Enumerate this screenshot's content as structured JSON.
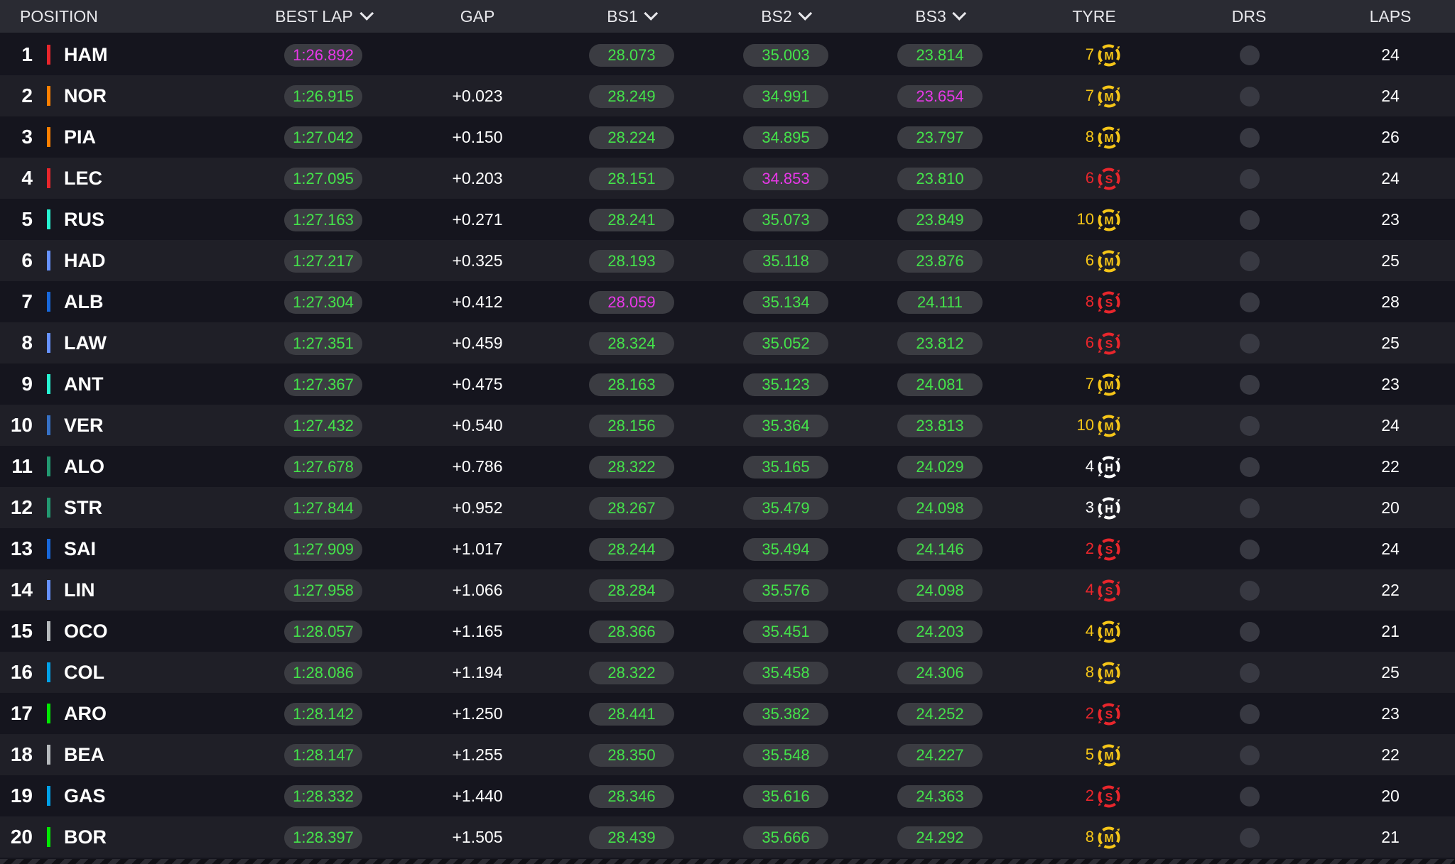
{
  "header": {
    "position": "POSITION",
    "best_lap": "BEST LAP",
    "gap": "GAP",
    "bs1": "BS1",
    "bs2": "BS2",
    "bs3": "BS3",
    "tyre": "TYRE",
    "drs": "DRS",
    "laps": "LAPS"
  },
  "colors": {
    "valid": "#44e34a",
    "best": "#e838e8",
    "medium": "#f5c518",
    "soft": "#e8262c",
    "hard": "#ffffff"
  },
  "rows": [
    {
      "pos": "1",
      "code": "HAM",
      "team_color": "#e8262c",
      "best_lap": "1:26.892",
      "best_is_overall": true,
      "gap": "",
      "bs1": "28.073",
      "bs1_best": false,
      "bs2": "35.003",
      "bs2_best": false,
      "bs3": "23.814",
      "bs3_best": false,
      "tyre_laps": "7",
      "tyre": "M",
      "laps": "24"
    },
    {
      "pos": "2",
      "code": "NOR",
      "team_color": "#ff8000",
      "best_lap": "1:26.915",
      "best_is_overall": false,
      "gap": "+0.023",
      "bs1": "28.249",
      "bs1_best": false,
      "bs2": "34.991",
      "bs2_best": false,
      "bs3": "23.654",
      "bs3_best": true,
      "tyre_laps": "7",
      "tyre": "M",
      "laps": "24"
    },
    {
      "pos": "3",
      "code": "PIA",
      "team_color": "#ff8000",
      "best_lap": "1:27.042",
      "best_is_overall": false,
      "gap": "+0.150",
      "bs1": "28.224",
      "bs1_best": false,
      "bs2": "34.895",
      "bs2_best": false,
      "bs3": "23.797",
      "bs3_best": false,
      "tyre_laps": "8",
      "tyre": "M",
      "laps": "26"
    },
    {
      "pos": "4",
      "code": "LEC",
      "team_color": "#e8262c",
      "best_lap": "1:27.095",
      "best_is_overall": false,
      "gap": "+0.203",
      "bs1": "28.151",
      "bs1_best": false,
      "bs2": "34.853",
      "bs2_best": true,
      "bs3": "23.810",
      "bs3_best": false,
      "tyre_laps": "6",
      "tyre": "S",
      "laps": "24"
    },
    {
      "pos": "5",
      "code": "RUS",
      "team_color": "#27f4d2",
      "best_lap": "1:27.163",
      "best_is_overall": false,
      "gap": "+0.271",
      "bs1": "28.241",
      "bs1_best": false,
      "bs2": "35.073",
      "bs2_best": false,
      "bs3": "23.849",
      "bs3_best": false,
      "tyre_laps": "10",
      "tyre": "M",
      "laps": "23"
    },
    {
      "pos": "6",
      "code": "HAD",
      "team_color": "#6692ff",
      "best_lap": "1:27.217",
      "best_is_overall": false,
      "gap": "+0.325",
      "bs1": "28.193",
      "bs1_best": false,
      "bs2": "35.118",
      "bs2_best": false,
      "bs3": "23.876",
      "bs3_best": false,
      "tyre_laps": "6",
      "tyre": "M",
      "laps": "25"
    },
    {
      "pos": "7",
      "code": "ALB",
      "team_color": "#1868db",
      "best_lap": "1:27.304",
      "best_is_overall": false,
      "gap": "+0.412",
      "bs1": "28.059",
      "bs1_best": true,
      "bs2": "35.134",
      "bs2_best": false,
      "bs3": "24.111",
      "bs3_best": false,
      "tyre_laps": "8",
      "tyre": "S",
      "laps": "28"
    },
    {
      "pos": "8",
      "code": "LAW",
      "team_color": "#6692ff",
      "best_lap": "1:27.351",
      "best_is_overall": false,
      "gap": "+0.459",
      "bs1": "28.324",
      "bs1_best": false,
      "bs2": "35.052",
      "bs2_best": false,
      "bs3": "23.812",
      "bs3_best": false,
      "tyre_laps": "6",
      "tyre": "S",
      "laps": "25"
    },
    {
      "pos": "9",
      "code": "ANT",
      "team_color": "#27f4d2",
      "best_lap": "1:27.367",
      "best_is_overall": false,
      "gap": "+0.475",
      "bs1": "28.163",
      "bs1_best": false,
      "bs2": "35.123",
      "bs2_best": false,
      "bs3": "24.081",
      "bs3_best": false,
      "tyre_laps": "7",
      "tyre": "M",
      "laps": "23"
    },
    {
      "pos": "10",
      "code": "VER",
      "team_color": "#3671c6",
      "best_lap": "1:27.432",
      "best_is_overall": false,
      "gap": "+0.540",
      "bs1": "28.156",
      "bs1_best": false,
      "bs2": "35.364",
      "bs2_best": false,
      "bs3": "23.813",
      "bs3_best": false,
      "tyre_laps": "10",
      "tyre": "M",
      "laps": "24"
    },
    {
      "pos": "11",
      "code": "ALO",
      "team_color": "#229971",
      "best_lap": "1:27.678",
      "best_is_overall": false,
      "gap": "+0.786",
      "bs1": "28.322",
      "bs1_best": false,
      "bs2": "35.165",
      "bs2_best": false,
      "bs3": "24.029",
      "bs3_best": false,
      "tyre_laps": "4",
      "tyre": "H",
      "laps": "22"
    },
    {
      "pos": "12",
      "code": "STR",
      "team_color": "#229971",
      "best_lap": "1:27.844",
      "best_is_overall": false,
      "gap": "+0.952",
      "bs1": "28.267",
      "bs1_best": false,
      "bs2": "35.479",
      "bs2_best": false,
      "bs3": "24.098",
      "bs3_best": false,
      "tyre_laps": "3",
      "tyre": "H",
      "laps": "20"
    },
    {
      "pos": "13",
      "code": "SAI",
      "team_color": "#1868db",
      "best_lap": "1:27.909",
      "best_is_overall": false,
      "gap": "+1.017",
      "bs1": "28.244",
      "bs1_best": false,
      "bs2": "35.494",
      "bs2_best": false,
      "bs3": "24.146",
      "bs3_best": false,
      "tyre_laps": "2",
      "tyre": "S",
      "laps": "24"
    },
    {
      "pos": "14",
      "code": "LIN",
      "team_color": "#6692ff",
      "best_lap": "1:27.958",
      "best_is_overall": false,
      "gap": "+1.066",
      "bs1": "28.284",
      "bs1_best": false,
      "bs2": "35.576",
      "bs2_best": false,
      "bs3": "24.098",
      "bs3_best": false,
      "tyre_laps": "4",
      "tyre": "S",
      "laps": "22"
    },
    {
      "pos": "15",
      "code": "OCO",
      "team_color": "#b6babd",
      "best_lap": "1:28.057",
      "best_is_overall": false,
      "gap": "+1.165",
      "bs1": "28.366",
      "bs1_best": false,
      "bs2": "35.451",
      "bs2_best": false,
      "bs3": "24.203",
      "bs3_best": false,
      "tyre_laps": "4",
      "tyre": "M",
      "laps": "21"
    },
    {
      "pos": "16",
      "code": "COL",
      "team_color": "#00a1e8",
      "best_lap": "1:28.086",
      "best_is_overall": false,
      "gap": "+1.194",
      "bs1": "28.322",
      "bs1_best": false,
      "bs2": "35.458",
      "bs2_best": false,
      "bs3": "24.306",
      "bs3_best": false,
      "tyre_laps": "8",
      "tyre": "M",
      "laps": "25"
    },
    {
      "pos": "17",
      "code": "ARO",
      "team_color": "#00e701",
      "best_lap": "1:28.142",
      "best_is_overall": false,
      "gap": "+1.250",
      "bs1": "28.441",
      "bs1_best": false,
      "bs2": "35.382",
      "bs2_best": false,
      "bs3": "24.252",
      "bs3_best": false,
      "tyre_laps": "2",
      "tyre": "S",
      "laps": "23"
    },
    {
      "pos": "18",
      "code": "BEA",
      "team_color": "#b6babd",
      "best_lap": "1:28.147",
      "best_is_overall": false,
      "gap": "+1.255",
      "bs1": "28.350",
      "bs1_best": false,
      "bs2": "35.548",
      "bs2_best": false,
      "bs3": "24.227",
      "bs3_best": false,
      "tyre_laps": "5",
      "tyre": "M",
      "laps": "22"
    },
    {
      "pos": "19",
      "code": "GAS",
      "team_color": "#00a1e8",
      "best_lap": "1:28.332",
      "best_is_overall": false,
      "gap": "+1.440",
      "bs1": "28.346",
      "bs1_best": false,
      "bs2": "35.616",
      "bs2_best": false,
      "bs3": "24.363",
      "bs3_best": false,
      "tyre_laps": "2",
      "tyre": "S",
      "laps": "20"
    },
    {
      "pos": "20",
      "code": "BOR",
      "team_color": "#00e701",
      "best_lap": "1:28.397",
      "best_is_overall": false,
      "gap": "+1.505",
      "bs1": "28.439",
      "bs1_best": false,
      "bs2": "35.666",
      "bs2_best": false,
      "bs3": "24.292",
      "bs3_best": false,
      "tyre_laps": "8",
      "tyre": "M",
      "laps": "21"
    }
  ]
}
